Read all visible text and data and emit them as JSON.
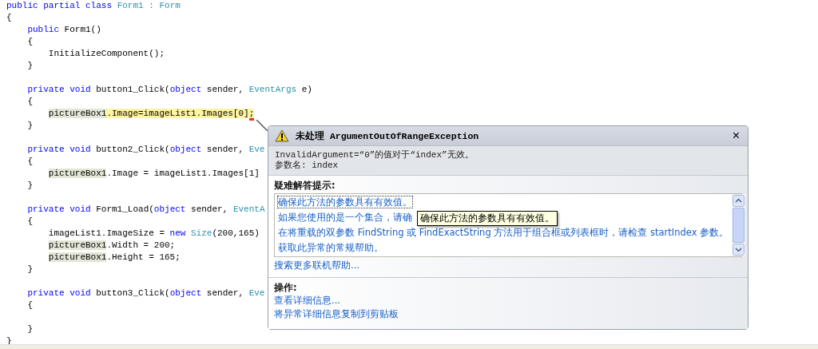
{
  "code": {
    "lines": [
      {
        "segments": [
          {
            "text": "public partial class ",
            "kind": "kw"
          },
          {
            "text": "Form1 : Form",
            "kind": "type"
          }
        ]
      },
      {
        "segments": [
          {
            "text": "{",
            "kind": "plain"
          }
        ],
        "children": [
          {
            "segments": [
              {
                "text": "public ",
                "kind": "kw"
              },
              {
                "text": "Form1()",
                "kind": "plain"
              }
            ]
          },
          {
            "segments": [
              {
                "text": "{",
                "kind": "plain"
              }
            ],
            "children": [
              {
                "segments": [
                  {
                    "text": "InitializeComponent();",
                    "kind": "plain"
                  }
                ]
              }
            ]
          },
          {
            "segments": [
              {
                "text": "}",
                "kind": "plain"
              }
            ],
            "gap_after": true
          },
          {
            "segments": [
              {
                "text": "private void ",
                "kind": "kw"
              },
              {
                "text": "button1_Click(",
                "kind": "plain"
              },
              {
                "text": "object ",
                "kind": "kw"
              },
              {
                "text": "sender, ",
                "kind": "plain"
              },
              {
                "text": "EventArgs ",
                "kind": "type"
              },
              {
                "text": "e)",
                "kind": "plain"
              }
            ]
          },
          {
            "segments": [
              {
                "text": "{",
                "kind": "plain"
              }
            ],
            "children": [
              {
                "segments": [
                  {
                    "text": "pictureBox1",
                    "kind": "ref"
                  },
                  {
                    "text": ".Image=imageList1.Images[0]",
                    "kind": "current"
                  },
                  {
                    "text": ";",
                    "kind": "error"
                  }
                ]
              }
            ]
          },
          {
            "segments": [
              {
                "text": "}",
                "kind": "plain"
              }
            ],
            "gap_after": true
          },
          {
            "segments": [
              {
                "text": "private void ",
                "kind": "kw"
              },
              {
                "text": "button2_Click(",
                "kind": "plain"
              },
              {
                "text": "object ",
                "kind": "kw"
              },
              {
                "text": "sender, ",
                "kind": "plain"
              },
              {
                "text": "Eve",
                "kind": "type"
              }
            ]
          },
          {
            "segments": [
              {
                "text": "{",
                "kind": "plain"
              }
            ],
            "children": [
              {
                "segments": [
                  {
                    "text": "pictureBox1",
                    "kind": "ref"
                  },
                  {
                    "text": ".Image = imageList1.Images[1]",
                    "kind": "plain"
                  }
                ]
              }
            ]
          },
          {
            "segments": [
              {
                "text": "}",
                "kind": "plain"
              }
            ],
            "gap_after": true
          },
          {
            "segments": [
              {
                "text": "private void ",
                "kind": "kw"
              },
              {
                "text": "Form1_Load(",
                "kind": "plain"
              },
              {
                "text": "object ",
                "kind": "kw"
              },
              {
                "text": "sender, ",
                "kind": "plain"
              },
              {
                "text": "EventA",
                "kind": "type"
              }
            ]
          },
          {
            "segments": [
              {
                "text": "{",
                "kind": "plain"
              }
            ],
            "children": [
              {
                "segments": [
                  {
                    "text": "imageList1.ImageSize = ",
                    "kind": "plain"
                  },
                  {
                    "text": "new ",
                    "kind": "kw"
                  },
                  {
                    "text": "Size",
                    "kind": "type"
                  },
                  {
                    "text": "(200,165)",
                    "kind": "plain"
                  }
                ]
              },
              {
                "segments": [
                  {
                    "text": "pictureBox1",
                    "kind": "ref"
                  },
                  {
                    "text": ".Width = 200;",
                    "kind": "plain"
                  }
                ]
              },
              {
                "segments": [
                  {
                    "text": "pictureBox1",
                    "kind": "ref"
                  },
                  {
                    "text": ".Height = 165;",
                    "kind": "plain"
                  }
                ]
              }
            ]
          },
          {
            "segments": [
              {
                "text": "}",
                "kind": "plain"
              }
            ],
            "gap_after": true
          },
          {
            "segments": [
              {
                "text": "private void ",
                "kind": "kw"
              },
              {
                "text": "button3_Click(",
                "kind": "plain"
              },
              {
                "text": "object ",
                "kind": "kw"
              },
              {
                "text": "sender, ",
                "kind": "plain"
              },
              {
                "text": "Eve",
                "kind": "type"
              }
            ]
          },
          {
            "segments": [
              {
                "text": "{",
                "kind": "plain"
              }
            ],
            "gap_after": true
          },
          {
            "segments": [
              {
                "text": "}",
                "kind": "plain"
              }
            ]
          }
        ]
      },
      {
        "segments": [
          {
            "text": "}",
            "kind": "plain"
          }
        ]
      }
    ]
  },
  "exception": {
    "title": "未处理 ArgumentOutOfRangeException",
    "close": "×",
    "message": [
      "InvalidArgument=“0”的值对于“index”无效。",
      "参数名: index"
    ],
    "troubleshooting_heading": "疑难解答提示:",
    "tips": [
      {
        "text": "确保此方法的参数具有有效值。",
        "focused": true
      },
      {
        "text": "如果您使用的是一个集合，请确",
        "focused": false
      },
      {
        "text": "在将重载的双参数 FindString 或 FindExactString 方法用于组合框或列表框时，请检查 startIndex 参数。",
        "focused": false
      },
      {
        "text": "获取此异常的常规帮助。",
        "focused": false
      }
    ],
    "tooltip": "确保此方法的参数具有有效值。",
    "help_link": "搜索更多联机帮助...",
    "actions_heading": "操作:",
    "actions": [
      "查看详细信息...",
      "将异常详细信息复制到剪贴板"
    ]
  }
}
